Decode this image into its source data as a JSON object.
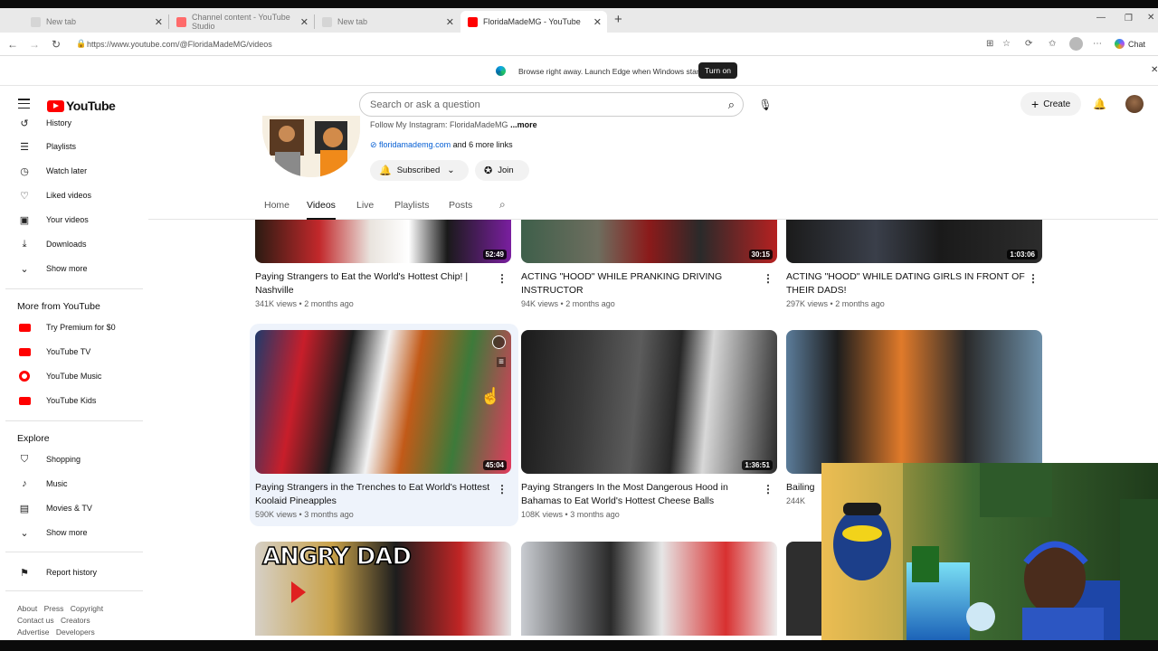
{
  "browser": {
    "tabs": [
      {
        "label": "New tab",
        "favicon_color": "#cfcfcf"
      },
      {
        "label": "Channel content - YouTube Studio",
        "favicon_color": "#ff5a5a"
      },
      {
        "label": "New tab",
        "favicon_color": "#cfcfcf"
      },
      {
        "label": "FloridaMadeMG - YouTube",
        "favicon_color": "#ff0000"
      }
    ],
    "new_tab": "+",
    "url": "https://www.youtube.com/@FloridaMadeMG/videos",
    "chat_label": "Chat"
  },
  "banner": {
    "text": "Browse right away. Launch Edge when Windows starts.",
    "button": "Turn on"
  },
  "youtube": {
    "logo": "YouTube",
    "search_placeholder": "Search or ask a question",
    "create_label": "Create"
  },
  "sidebar": {
    "items": [
      {
        "label": "History",
        "icon": "history-icon",
        "glyph": "↺"
      },
      {
        "label": "Playlists",
        "icon": "playlists-icon",
        "glyph": "☰"
      },
      {
        "label": "Watch later",
        "icon": "watch-later-icon",
        "glyph": "◷"
      },
      {
        "label": "Liked videos",
        "icon": "like-icon",
        "glyph": "👍"
      },
      {
        "label": "Your videos",
        "icon": "your-videos-icon",
        "glyph": "▶"
      },
      {
        "label": "Downloads",
        "icon": "download-icon",
        "glyph": "⤓"
      },
      {
        "label": "Show more",
        "icon": "chevron-down-icon",
        "glyph": "⌄"
      }
    ],
    "more_heading": "More from YouTube",
    "more_items": [
      {
        "label": "Try Premium for $0",
        "icon": "youtube-premium-icon"
      },
      {
        "label": "YouTube TV",
        "icon": "youtube-tv-icon"
      },
      {
        "label": "YouTube Music",
        "icon": "youtube-music-icon"
      },
      {
        "label": "YouTube Kids",
        "icon": "youtube-kids-icon"
      }
    ],
    "explore_heading": "Explore",
    "explore_items": [
      {
        "label": "Shopping",
        "icon": "shopping-icon",
        "glyph": "🛍"
      },
      {
        "label": "Music",
        "icon": "music-icon",
        "glyph": "♪"
      },
      {
        "label": "Movies & TV",
        "icon": "movies-icon",
        "glyph": "🎞"
      },
      {
        "label": "Show more",
        "icon": "chevron-down-icon",
        "glyph": "⌄"
      }
    ],
    "report_history": "Report history",
    "footer_row1": [
      "About",
      "Press",
      "Copyright"
    ],
    "footer_row2": [
      "Contact us",
      "Creators"
    ],
    "footer_row3": [
      "Advertise",
      "Developers"
    ]
  },
  "channel": {
    "description": "Follow My Instagram: FloridaMadeMG",
    "more": "...more",
    "link": "floridamademg.com",
    "more_links": "and 6 more links",
    "subscribed": "Subscribed",
    "join": "Join",
    "tabs": [
      "Home",
      "Videos",
      "Live",
      "Playlists",
      "Posts"
    ],
    "active_tab": "Videos"
  },
  "videos": [
    {
      "title": "Paying Strangers to Eat the World's Hottest Chip! | Nashville",
      "views": "341K views",
      "age": "2 months ago",
      "duration": "52:49"
    },
    {
      "title": "ACTING \"HOOD\" WHILE PRANKING DRIVING INSTRUCTOR",
      "views": "94K views",
      "age": "2 months ago",
      "duration": "30:15"
    },
    {
      "title": "ACTING \"HOOD\" WHILE DATING GIRLS IN FRONT OF THEIR DADS!",
      "views": "297K views",
      "age": "2 months ago",
      "duration": "1:03:06"
    },
    {
      "title": "Paying Strangers in the Trenches to Eat World's Hottest Koolaid Pineapples",
      "views": "590K views",
      "age": "3 months ago",
      "duration": "45:04"
    },
    {
      "title": "Paying Strangers In the Most Dangerous Hood in Bahamas to Eat World's Hottest Cheese Balls",
      "views": "108K views",
      "age": "3 months ago",
      "duration": "1:36:51"
    },
    {
      "title": "Bailing",
      "views": "244K",
      "age": "",
      "duration": ""
    },
    {
      "title": "",
      "views": "",
      "age": "",
      "duration": "",
      "thumb_text": "ANGRY DAD"
    },
    {
      "title": "",
      "views": "",
      "age": "",
      "duration": ""
    },
    {
      "title": "",
      "views": "",
      "age": "",
      "duration": ""
    }
  ],
  "colors": {
    "accent": "#ff0000",
    "link": "#065fd4",
    "hover_bg": "#eef3fb"
  }
}
